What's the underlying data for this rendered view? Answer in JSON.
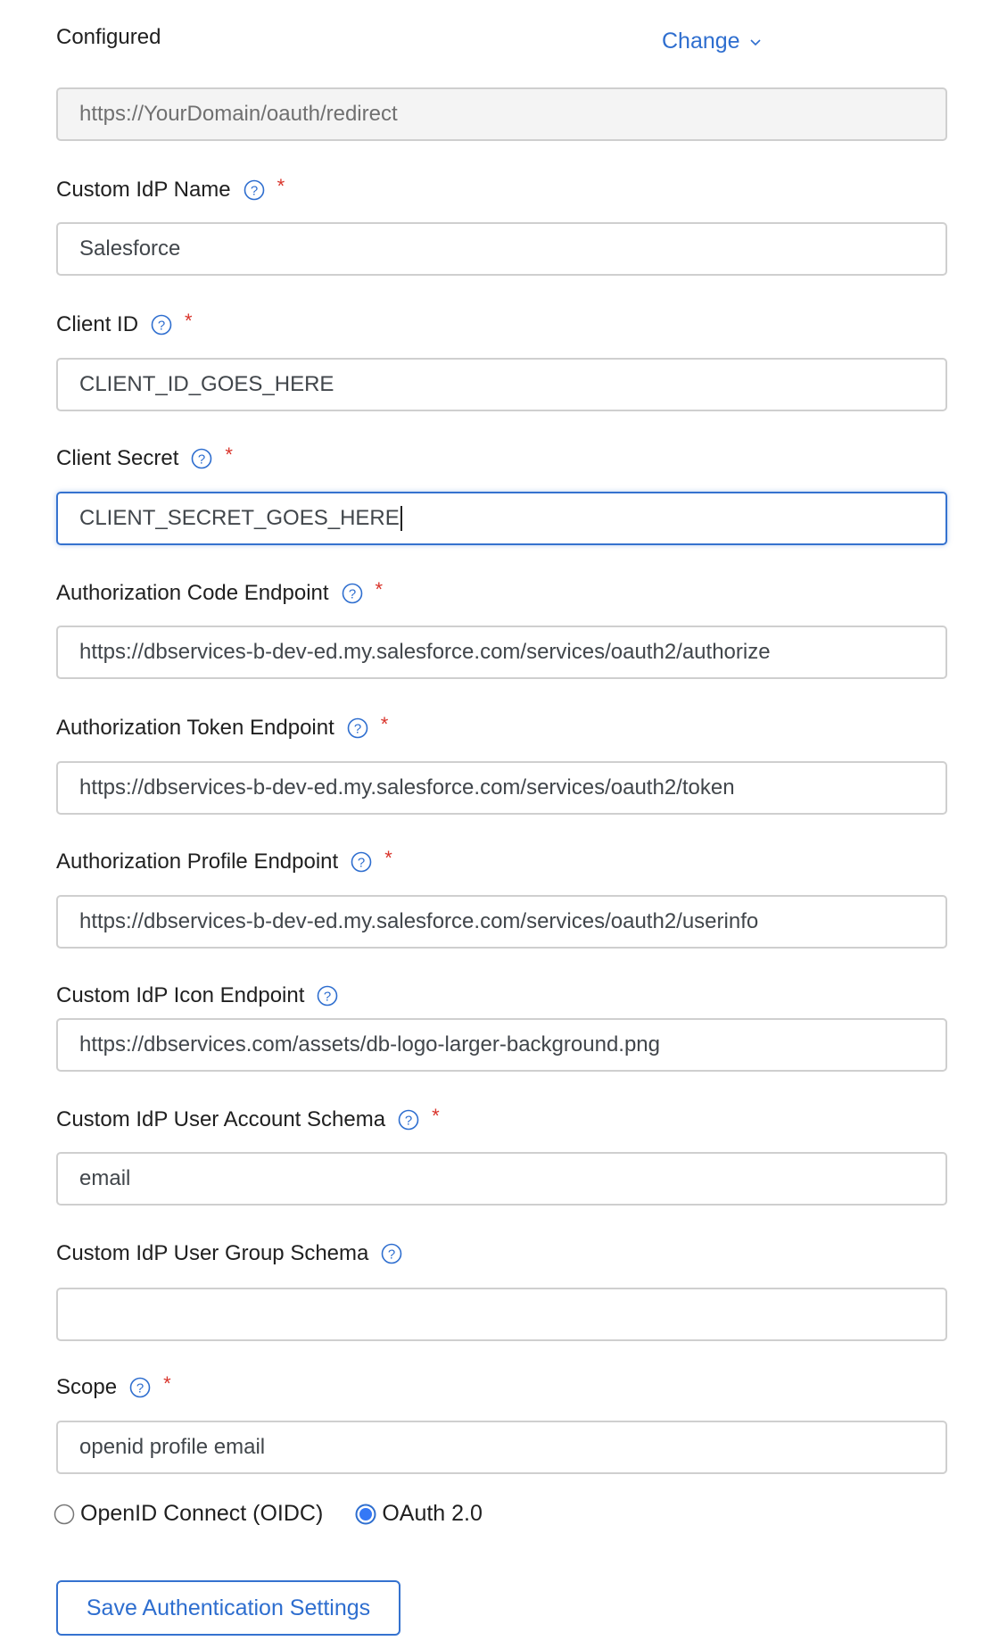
{
  "header": {
    "status_label": "Configured",
    "change_label": "Change"
  },
  "redirect": {
    "value": "https://YourDomain/oauth/redirect"
  },
  "fields": [
    {
      "label": "Custom IdP Name",
      "value": "Salesforce",
      "required": true
    },
    {
      "label": "Client ID",
      "value": "CLIENT_ID_GOES_HERE",
      "required": true
    },
    {
      "label": "Client Secret",
      "value": "CLIENT_SECRET_GOES_HERE",
      "required": true,
      "focused": true
    },
    {
      "label": "Authorization Code Endpoint",
      "value": "https://dbservices-b-dev-ed.my.salesforce.com/services/oauth2/authorize",
      "required": true
    },
    {
      "label": "Authorization Token Endpoint",
      "value": "https://dbservices-b-dev-ed.my.salesforce.com/services/oauth2/token",
      "required": true
    },
    {
      "label": "Authorization Profile Endpoint",
      "value": "https://dbservices-b-dev-ed.my.salesforce.com/services/oauth2/userinfo",
      "required": true
    },
    {
      "label": "Custom IdP Icon Endpoint",
      "value": "https://dbservices.com/assets/db-logo-larger-background.png",
      "required": false
    },
    {
      "label": "Custom IdP User Account Schema",
      "value": "email",
      "required": true
    },
    {
      "label": "Custom IdP User Group Schema",
      "value": "",
      "required": false
    },
    {
      "label": "Scope",
      "value": "openid profile email",
      "required": true
    }
  ],
  "required_marker": "*",
  "protocol": {
    "options": [
      {
        "label": "OpenID Connect (OIDC)",
        "selected": false
      },
      {
        "label": "OAuth 2.0",
        "selected": true
      }
    ]
  },
  "actions": {
    "save_label": "Save Authentication Settings"
  },
  "colors": {
    "accent": "#2e6ecf",
    "required": "#d9342b",
    "border": "#cfcfcf",
    "readonly_bg": "#f4f4f4"
  }
}
